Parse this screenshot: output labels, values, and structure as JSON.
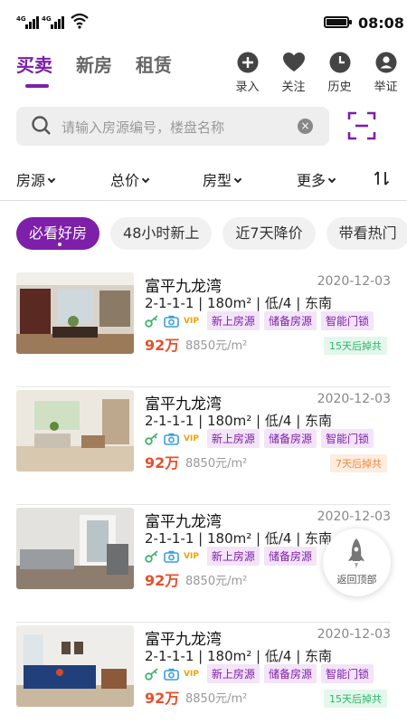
{
  "status_bar": {
    "network1": "4G",
    "network2": "4G",
    "time": "08:08"
  },
  "tabs": [
    {
      "label": "买卖",
      "active": true
    },
    {
      "label": "新房",
      "active": false
    },
    {
      "label": "租赁",
      "active": false
    }
  ],
  "actions": [
    {
      "label": "录入",
      "icon": "plus-circle-icon"
    },
    {
      "label": "关注",
      "icon": "heart-icon"
    },
    {
      "label": "历史",
      "icon": "clock-icon"
    },
    {
      "label": "举证",
      "icon": "person-icon"
    }
  ],
  "search": {
    "placeholder": "请输入房源编号，楼盘名称"
  },
  "filters": [
    {
      "label": "房源"
    },
    {
      "label": "总价"
    },
    {
      "label": "房型"
    },
    {
      "label": "更多"
    }
  ],
  "chips": [
    {
      "label": "必看好房",
      "active": true
    },
    {
      "label": "48小时新上",
      "active": false
    },
    {
      "label": "近7天降价",
      "active": false
    },
    {
      "label": "带看热门",
      "active": false
    }
  ],
  "listings": [
    {
      "name": "富平九龙湾",
      "date": "2020-12-03",
      "spec": "2-1-1-1 | 180m² | 低/4 | 东南",
      "vip": "VIP",
      "tags": [
        "新上房源",
        "储备房源",
        "智能门锁"
      ],
      "price": "92万",
      "unit_price": "8850元/m²",
      "badge": "15天后掉共",
      "badge_color": "green"
    },
    {
      "name": "富平九龙湾",
      "date": "2020-12-03",
      "spec": "2-1-1-1 | 180m² | 低/4 | 东南",
      "vip": "VIP",
      "tags": [
        "新上房源",
        "储备房源",
        "智能门锁"
      ],
      "price": "92万",
      "unit_price": "8850元/m²",
      "badge": "7天后掉共",
      "badge_color": "orange"
    },
    {
      "name": "富平九龙湾",
      "date": "2020-12-03",
      "spec": "2-1-1-1 | 180m² | 低/4 | 东南",
      "vip": "VIP",
      "tags": [
        "新上房源",
        "储备房源"
      ],
      "price": "92万",
      "unit_price": "8850元/m²",
      "badge": "",
      "badge_color": "orange"
    },
    {
      "name": "富平九龙湾",
      "date": "2020-12-03",
      "spec": "2-1-1-1 | 180m² | 低/4 | 东南",
      "vip": "VIP",
      "tags": [
        "新上房源",
        "储备房源",
        "智能门锁"
      ],
      "price": "92万",
      "unit_price": "8850元/m²",
      "badge": "15天后掉共",
      "badge_color": "green"
    }
  ],
  "back_to_top": {
    "label": "返回顶部"
  },
  "colors": {
    "accent": "#7d1fa8",
    "price": "#e6502c"
  }
}
